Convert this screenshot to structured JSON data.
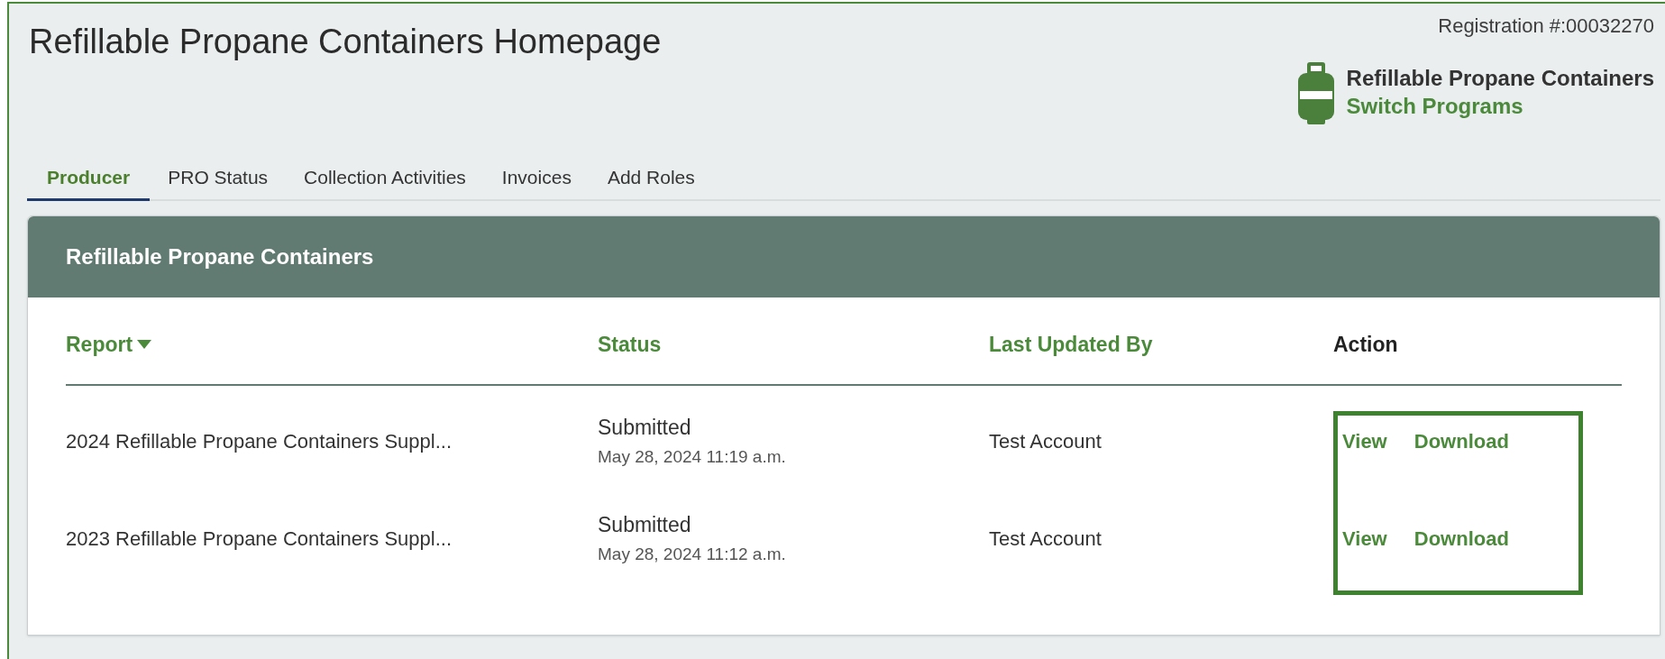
{
  "page": {
    "title": "Refillable Propane Containers Homepage",
    "registration": "Registration #:00032270"
  },
  "program": {
    "name": "Refillable Propane Containers",
    "switch_link": "Switch Programs"
  },
  "tabs": [
    {
      "label": "Producer",
      "selected": true
    },
    {
      "label": "PRO Status",
      "selected": false
    },
    {
      "label": "Collection Activities",
      "selected": false
    },
    {
      "label": "Invoices",
      "selected": false
    },
    {
      "label": "Add Roles",
      "selected": false
    }
  ],
  "card": {
    "title": "Refillable Propane Containers",
    "columns": [
      {
        "label": "Report",
        "sortable": true,
        "sorted": true
      },
      {
        "label": "Status",
        "sortable": true,
        "sorted": false
      },
      {
        "label": "Last Updated By",
        "sortable": true,
        "sorted": false
      },
      {
        "label": "Action",
        "sortable": false,
        "sorted": false
      }
    ],
    "rows": [
      {
        "report": "2024 Refillable Propane Containers Suppl...",
        "status": "Submitted",
        "date": "May 28, 2024 11:19 a.m.",
        "updated_by": "Test Account",
        "actions": [
          "View",
          "Download"
        ]
      },
      {
        "report": "2023 Refillable Propane Containers Suppl...",
        "status": "Submitted",
        "date": "May 28, 2024 11:12 a.m.",
        "updated_by": "Test Account",
        "actions": [
          "View",
          "Download"
        ]
      }
    ],
    "actions_highlighted": true
  }
}
